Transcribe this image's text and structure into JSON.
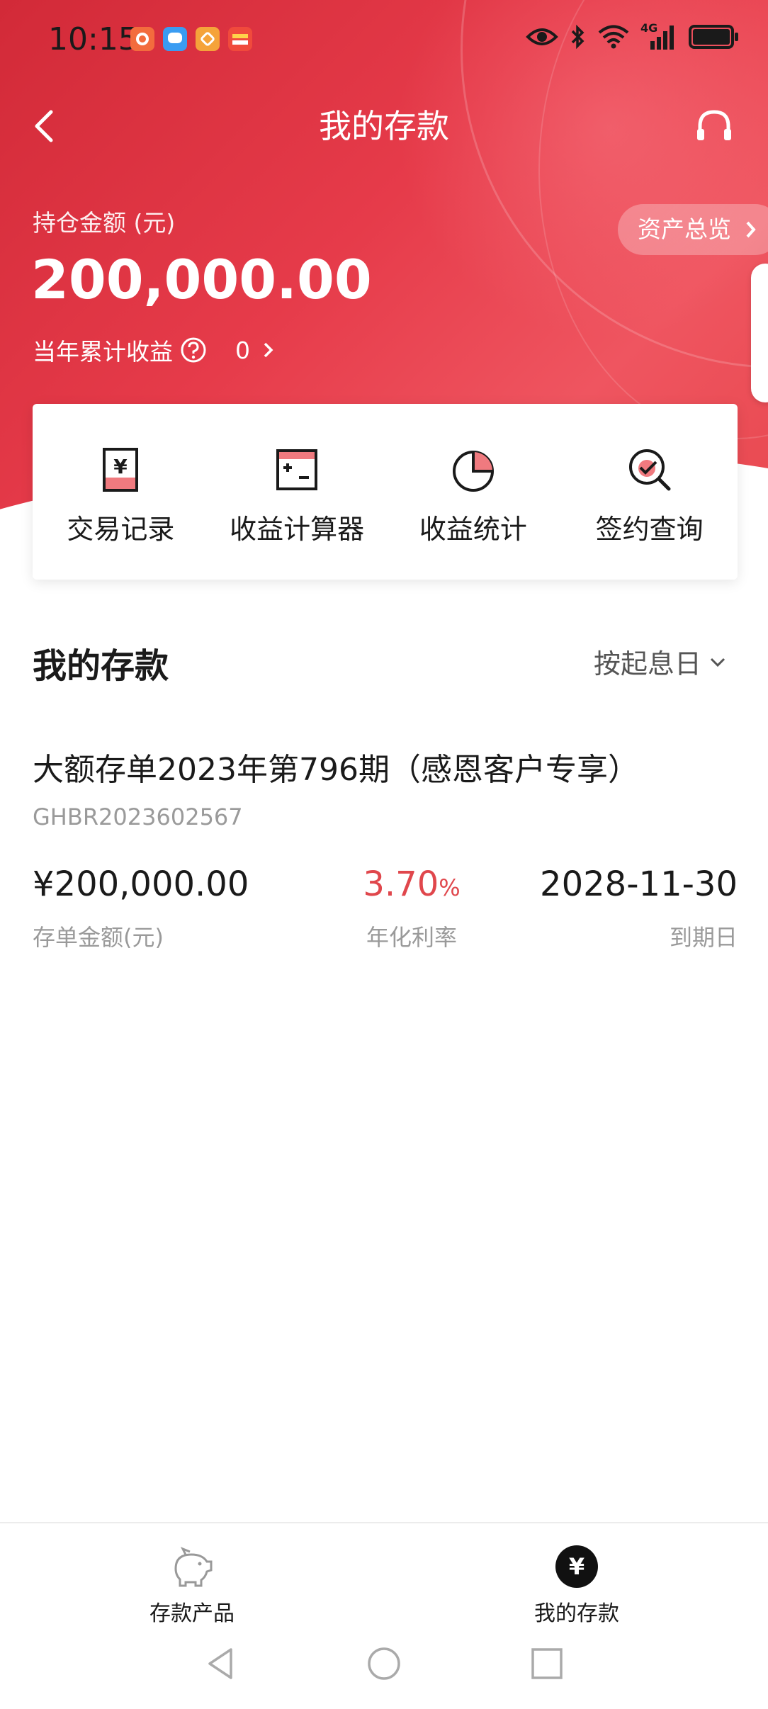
{
  "status_bar": {
    "time": "10:15",
    "network": "4G"
  },
  "header": {
    "title": "我的存款",
    "overview_label": "资产总览"
  },
  "summary": {
    "holding_label": "持仓金额 (元)",
    "holding_value": "200,000.00",
    "profit_label": "当年累计收益",
    "profit_value": "0"
  },
  "actions": [
    {
      "label": "交易记录",
      "icon": "yuan-receipt-icon"
    },
    {
      "label": "收益计算器",
      "icon": "calculator-icon"
    },
    {
      "label": "收益统计",
      "icon": "pie-chart-icon"
    },
    {
      "label": "签约查询",
      "icon": "magnifier-check-icon"
    }
  ],
  "section": {
    "title": "我的存款",
    "sort_label": "按起息日"
  },
  "deposits": [
    {
      "name": "大额存单2023年第796期（感恩客户专享）",
      "code": "GHBR2023602567",
      "amount": "¥200,000.00",
      "amount_label": "存单金额(元)",
      "rate": "3.70",
      "rate_unit": "%",
      "rate_label": "年化利率",
      "maturity": "2028-11-30",
      "maturity_label": "到期日"
    }
  ],
  "tabbar": {
    "products_label": "存款产品",
    "mine_label": "我的存款"
  },
  "colors": {
    "brand_red": "#e63b4a",
    "rate_red": "#e0474c"
  }
}
